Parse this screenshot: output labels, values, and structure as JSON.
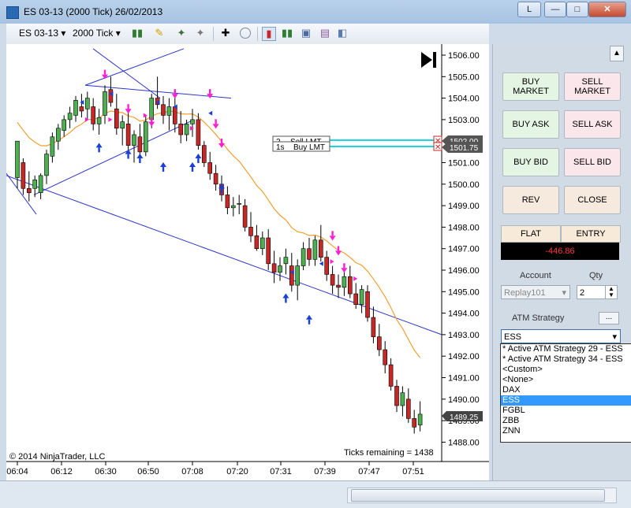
{
  "window": {
    "title": "ES 03-13 (2000 Tick)  26/02/2013",
    "lang_btn": "L",
    "min_icon": "minimize-icon",
    "max_icon": "maximize-icon",
    "close_icon": "close-icon"
  },
  "toolbar": {
    "instrument": "ES 03-13",
    "interval": "2000 Tick"
  },
  "chart": {
    "copyright": "© 2014 NinjaTrader, LLC",
    "ticks_remaining": "Ticks remaining = 1438",
    "price_labels": [
      "1506.00",
      "1505.00",
      "1504.00",
      "1503.00",
      "1502.00",
      "1501.00",
      "1500.00",
      "1499.00",
      "1498.00",
      "1497.00",
      "1496.00",
      "1495.00",
      "1494.00",
      "1493.00",
      "1492.00",
      "1491.00",
      "1490.00",
      "1489.00",
      "1488.00"
    ],
    "time_labels": [
      "06:04",
      "06:12",
      "06:30",
      "06:50",
      "07:08",
      "07:20",
      "07:31",
      "07:39",
      "07:47",
      "07:51"
    ],
    "current_price": "1489.25",
    "order_sell": {
      "qty": "2",
      "label": "Sell LMT",
      "price": "1502.00"
    },
    "order_buy": {
      "qty": "1s",
      "label": "Buy LMT",
      "price": "1501.75"
    }
  },
  "panel": {
    "buy_market": "BUY MARKET",
    "sell_market": "SELL MARKET",
    "buy_ask": "BUY ASK",
    "sell_ask": "SELL ASK",
    "buy_bid": "BUY BID",
    "sell_bid": "SELL BID",
    "rev": "REV",
    "close": "CLOSE",
    "flat": "FLAT",
    "entry": "ENTRY",
    "pnl": "-446.86",
    "account_label": "Account",
    "qty_label": "Qty",
    "account_value": "Replay101",
    "qty_value": "2",
    "atm_label": "ATM Strategy",
    "atm_more": "...",
    "atm_value": "ESS",
    "atm_options": [
      "* Active ATM Strategy 29 - ESS",
      "* Active ATM Strategy 34 - ESS",
      "<Custom>",
      "<None>",
      "DAX",
      "ESS",
      "FGBL",
      "ZBB",
      "ZNN"
    ],
    "atm_selected_index": 5
  },
  "colors": {
    "up": "#4caf50",
    "down": "#c62828",
    "trend": "#2d35c8",
    "ema": "#f0a030",
    "marker_buy": "#1a3fd6",
    "marker_sell": "#ff1fd1"
  }
}
